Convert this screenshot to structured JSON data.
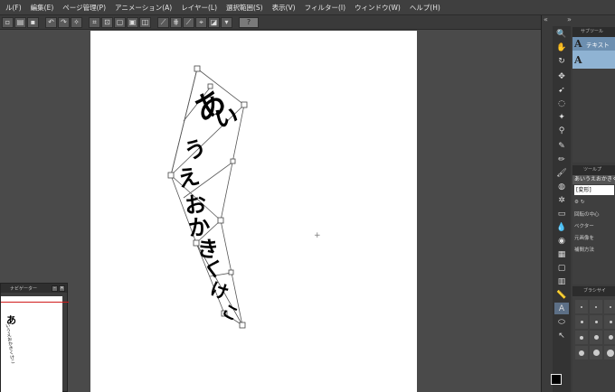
{
  "menubar": {
    "items": [
      "ル(F)",
      "編集(E)",
      "ページ管理(P)",
      "アニメーション(A)",
      "レイヤー(L)",
      "選択範囲(S)",
      "表示(V)",
      "フィルター(I)",
      "ウィンドウ(W)",
      "ヘルプ(H)"
    ]
  },
  "canvas": {
    "text_lines": [
      "あ",
      "い",
      "う",
      "え",
      "お",
      "か",
      "き",
      "く",
      "け",
      "こ"
    ]
  },
  "navigator": {
    "title": "ナビゲーター",
    "min_btn": "–",
    "close_btn": "✕",
    "preview_text": [
      "あ",
      "いうえおかきくけこ"
    ]
  },
  "right_dock": {
    "collapse": "«",
    "expand": "»",
    "subtool_header": "サブツール",
    "subtool_selected_label": "テキスト",
    "subtool_main_glyph": "A",
    "tool_property_header": "ツールプ",
    "tool_property_title": "あいうえおかきくけ",
    "transform_label": "[変形]",
    "rotation_center_label": "回転の中心",
    "vector_label": "ベクター",
    "original_image_label": "元画像を",
    "interpolation_label": "補間方法",
    "brush_size_header": "ブラシサイ"
  },
  "colors": {
    "accent": "#6d8fb0",
    "selection": "#8fb3d3",
    "redline": "#d01a1a",
    "canvas": "#ffffff"
  }
}
